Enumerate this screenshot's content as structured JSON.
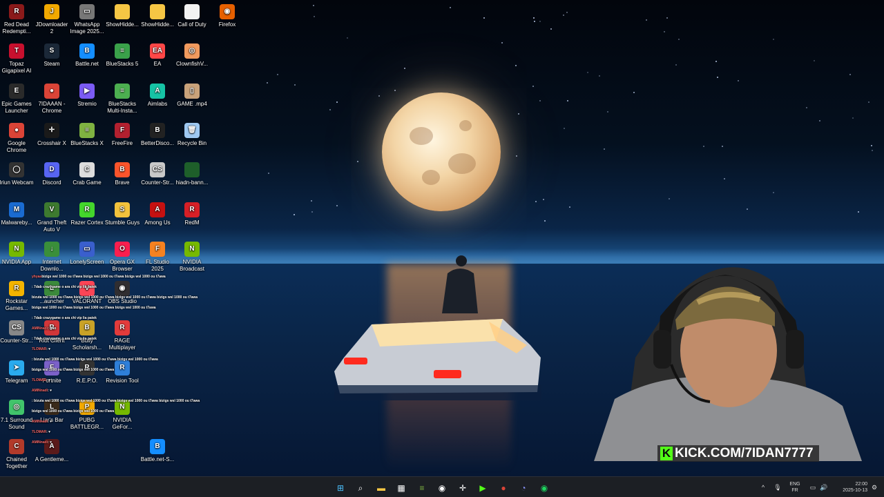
{
  "desktop": {
    "icons": [
      {
        "label": "Red Dead Redempti...",
        "icon": "red-dead-icon",
        "color": "#8b1a1a",
        "glyph": "R"
      },
      {
        "label": "JDownloader 2",
        "icon": "jdownloader-icon",
        "color": "#f2a900",
        "glyph": "J"
      },
      {
        "label": "WhatsApp Image 2025...",
        "icon": "image-file-icon",
        "color": "#777777",
        "glyph": "▭"
      },
      {
        "label": "ShowHidde...",
        "icon": "folder-icon",
        "color": "#f6c644",
        "glyph": ""
      },
      {
        "label": "ShowHidde...",
        "icon": "folder-icon",
        "color": "#f6c644",
        "glyph": ""
      },
      {
        "label": "Call of Duty",
        "icon": "document-icon",
        "color": "#f2f2f2",
        "glyph": ""
      },
      {
        "label": "Firefox",
        "icon": "firefox-icon",
        "color": "#e66000",
        "glyph": "◉"
      },
      {
        "label": "Topaz Gigapixel AI",
        "icon": "topaz-icon",
        "color": "#c8102e",
        "glyph": "T"
      },
      {
        "label": "Steam",
        "icon": "steam-icon",
        "color": "#1b2838",
        "glyph": "S"
      },
      {
        "label": "Battle.net",
        "icon": "battlenet-icon",
        "color": "#148eff",
        "glyph": "B"
      },
      {
        "label": "BlueStacks 5",
        "icon": "bluestacks-icon",
        "color": "#3aa14a",
        "glyph": "≡"
      },
      {
        "label": "EA",
        "icon": "ea-icon",
        "color": "#ff4747",
        "glyph": "EA"
      },
      {
        "label": "ClownfishV...",
        "icon": "clownfish-icon",
        "color": "#f19a5e",
        "glyph": "◎"
      },
      {
        "label": "Epic Games Launcher",
        "icon": "epic-games-icon",
        "color": "#2a2a2a",
        "glyph": "E"
      },
      {
        "label": "7IDAAAN - Chrome",
        "icon": "chrome-icon",
        "color": "#db4437",
        "glyph": "●"
      },
      {
        "label": "Stremio",
        "icon": "stremio-icon",
        "color": "#7b5bf5",
        "glyph": "▶"
      },
      {
        "label": "BlueStacks Multi-Insta...",
        "icon": "bluestacks-multi-icon",
        "color": "#4caf50",
        "glyph": "≡"
      },
      {
        "label": "Aimlabs",
        "icon": "aimlabs-icon",
        "color": "#16c3a5",
        "glyph": "A"
      },
      {
        "label": "GAME .mp4",
        "icon": "video-file-icon",
        "color": "#c9a27a",
        "glyph": "▯"
      },
      {
        "label": "Google Chrome",
        "icon": "chrome-icon",
        "color": "#db4437",
        "glyph": "●"
      },
      {
        "label": "Crosshair X",
        "icon": "crosshair-icon",
        "color": "#1a1a1a",
        "glyph": "✛"
      },
      {
        "label": "BlueStacks X",
        "icon": "bluestacks-x-icon",
        "color": "#7fb241",
        "glyph": "≡"
      },
      {
        "label": "FreeFire",
        "icon": "freefire-icon",
        "color": "#b3202f",
        "glyph": "F"
      },
      {
        "label": "BetterDisco...",
        "icon": "betterdiscord-icon",
        "color": "#222222",
        "glyph": "B"
      },
      {
        "label": "Recycle Bin",
        "icon": "recycle-bin-icon",
        "color": "#9fc9f2",
        "glyph": "🗑"
      },
      {
        "label": "Iriun Webcam",
        "icon": "webcam-icon",
        "color": "#333333",
        "glyph": "◯"
      },
      {
        "label": "Discord",
        "icon": "discord-icon",
        "color": "#5865f2",
        "glyph": "D"
      },
      {
        "label": "Crab Game",
        "icon": "crab-game-icon",
        "color": "#dddddd",
        "glyph": "C"
      },
      {
        "label": "Brave",
        "icon": "brave-icon",
        "color": "#fb542b",
        "glyph": "B"
      },
      {
        "label": "Counter-Str...",
        "icon": "counter-strike-icon",
        "color": "#c9c9c9",
        "glyph": "CS"
      },
      {
        "label": "hiadn-bann...",
        "icon": "file-icon",
        "color": "#1e5f2a",
        "glyph": ""
      },
      {
        "label": "Malwareby...",
        "icon": "malwarebytes-icon",
        "color": "#1a6bd1",
        "glyph": "M"
      },
      {
        "label": "Grand Theft Auto V",
        "icon": "gta-icon",
        "color": "#3d7a2f",
        "glyph": "V"
      },
      {
        "label": "Razer Cortex",
        "icon": "razer-icon",
        "color": "#44d62c",
        "glyph": "R"
      },
      {
        "label": "Stumble Guys",
        "icon": "stumble-guys-icon",
        "color": "#f2c23c",
        "glyph": "S"
      },
      {
        "label": "Among Us",
        "icon": "among-us-icon",
        "color": "#c51111",
        "glyph": "A"
      },
      {
        "label": "RedM",
        "icon": "redm-icon",
        "color": "#d61f26",
        "glyph": "R"
      },
      {
        "label": "NVIDIA App",
        "icon": "nvidia-icon",
        "color": "#76b900",
        "glyph": "N"
      },
      {
        "label": "Internet Downlo...",
        "icon": "idm-icon",
        "color": "#3a8f3a",
        "glyph": "↓"
      },
      {
        "label": "LonelyScreen",
        "icon": "lonelyscreen-icon",
        "color": "#3a5fcd",
        "glyph": "▭"
      },
      {
        "label": "Opera GX Browser",
        "icon": "opera-gx-icon",
        "color": "#fa1e4e",
        "glyph": "O"
      },
      {
        "label": "FL Studio 2025",
        "icon": "fl-studio-icon",
        "color": "#f58220",
        "glyph": "F"
      },
      {
        "label": "NVIDIA Broadcast",
        "icon": "nvidia-broadcast-icon",
        "color": "#76b900",
        "glyph": "N"
      },
      {
        "label": "Rockstar Games...",
        "icon": "rockstar-icon",
        "color": "#f4b400",
        "glyph": "R"
      },
      {
        "label": "...auncher",
        "icon": "launcher-icon",
        "color": "#3b8a3b",
        "glyph": "L"
      },
      {
        "label": "VALORANT",
        "icon": "valorant-icon",
        "color": "#fd4556",
        "glyph": "V"
      },
      {
        "label": "OBS Studio",
        "icon": "obs-icon",
        "color": "#302e31",
        "glyph": "◉"
      },
      {
        "label": "Counter-Str...",
        "icon": "counter-strike-icon",
        "color": "#888888",
        "glyph": "CS"
      },
      {
        "label": "Riot Client",
        "icon": "riot-icon",
        "color": "#d13639",
        "glyph": "R"
      },
      {
        "label": "Bully Scholarsh...",
        "icon": "bully-icon",
        "color": "#c9a227",
        "glyph": "B"
      },
      {
        "label": "RAGE Multiplayer",
        "icon": "ragemp-icon",
        "color": "#e23b3b",
        "glyph": "R"
      },
      {
        "label": "Telegram",
        "icon": "telegram-icon",
        "color": "#2aabee",
        "glyph": "➤"
      },
      {
        "label": "Fortnite",
        "icon": "fortnite-icon",
        "color": "#7b61c9",
        "glyph": "F"
      },
      {
        "label": "R.E.P.O.",
        "icon": "repo-icon",
        "color": "#333333",
        "glyph": "R"
      },
      {
        "label": "Revision Tool",
        "icon": "revision-tool-icon",
        "color": "#2e7fd9",
        "glyph": "R"
      },
      {
        "label": "7.1 Surround Sound",
        "icon": "surround-sound-icon",
        "color": "#41c46b",
        "glyph": "◎"
      },
      {
        "label": "Liar's Bar",
        "icon": "liars-bar-icon",
        "color": "#3a2a1a",
        "glyph": "L"
      },
      {
        "label": "PUBG BATTLEGR...",
        "icon": "pubg-icon",
        "color": "#f2a900",
        "glyph": "P"
      },
      {
        "label": "NVIDIA GeFor...",
        "icon": "nvidia-geforce-icon",
        "color": "#76b900",
        "glyph": "N"
      },
      {
        "label": "Chained Together",
        "icon": "chained-together-icon",
        "color": "#b23a2a",
        "glyph": "C"
      },
      {
        "label": "A Gentleme...",
        "icon": "gentleman-icon",
        "color": "#5a1a1a",
        "glyph": "A"
      },
      {
        "label": "Battle.net-S...",
        "icon": "battlenet-icon",
        "color": "#148eff",
        "glyph": "B"
      }
    ]
  },
  "chat": {
    "messages": [
      {
        "user": "yhyaa",
        "text": "bizigs wsl 1000 ou t7awa bizigs wsl 1000 ou t7awa bizigs wsl 1000 ou t7awa"
      },
      {
        "user": "",
        "text": ": 7dab crazygame o ara chi vip lia patek"
      },
      {
        "user": "",
        "text": "bizuta wsl 1000 ou t7awa bizigs wsl 1000 ou t7awa bizigs wsl 1000 ou t7awa bizigs wsl 1000 ou t7awa"
      },
      {
        "user": "",
        "text": "bizigs wsl 1000 ou t7awa bizigs wsl 1000 ou t7awa bizigs wsl 1000 ou t7awa"
      },
      {
        "user": "",
        "text": ": 7dab crazygame o ara chi vip lia patek"
      },
      {
        "user": "AMINnadi",
        "text": ": goo"
      },
      {
        "user": "",
        "text": ": 7dab crazygame o ara chi vip lia patek"
      },
      {
        "user": "7LOMAR",
        "text": ": ♥"
      },
      {
        "user": "",
        "text": ": bizuta wsl 1000 ou t7awa bizigs wsl 1000 ou t7awa bizigs wsl 1000 ou t7awa"
      },
      {
        "user": "",
        "text": "bizigs wsl 1000 ou t7awa bizigs wsl 1000 ou t7awa"
      },
      {
        "user": "7LOMAR",
        "text": ": ♥"
      },
      {
        "user": "AMINnadi",
        "text": ": ♥"
      },
      {
        "user": "",
        "text": ": bizuta wsl 1000 ou t7awa bizigs wsl 1000 ou t7awa bizigs wsl 1000 ou t7awa bizigs wsl 1000 ou t7awa"
      },
      {
        "user": "",
        "text": "bizigs wsl 1000 ou t7awa bizigs wsl 1000 ou t7awa"
      },
      {
        "user": "AMINnadi",
        "text": ": ♥"
      },
      {
        "user": "7LOMAR",
        "text": ": ♥"
      },
      {
        "user": "AMINnadi",
        "text": ": ♥"
      }
    ]
  },
  "stream": {
    "banner_k": "K",
    "banner_text": "KICK.COM/7IDAN7777",
    "accent": "#53fc18"
  },
  "taskbar": {
    "buttons": [
      {
        "name": "start-button",
        "icon": "windows-icon",
        "glyph": "⊞",
        "color": "#4cc2ff"
      },
      {
        "name": "search-button",
        "icon": "search-icon",
        "glyph": "⌕",
        "color": "#ffffff"
      },
      {
        "name": "file-explorer-button",
        "icon": "folder-icon",
        "glyph": "▬",
        "color": "#f6c644"
      },
      {
        "name": "store-button",
        "icon": "store-icon",
        "glyph": "▦",
        "color": "#ffffff"
      },
      {
        "name": "bluestacks-button",
        "icon": "bluestacks-icon",
        "glyph": "≡",
        "color": "#7fb241"
      },
      {
        "name": "obs-button",
        "icon": "obs-icon",
        "glyph": "◉",
        "color": "#ffffff"
      },
      {
        "name": "crosshair-button",
        "icon": "crosshair-icon",
        "glyph": "✛",
        "color": "#ffffff"
      },
      {
        "name": "streamlabs-button",
        "icon": "play-icon",
        "glyph": "▶",
        "color": "#53fc18"
      },
      {
        "name": "chrome-button",
        "icon": "chrome-icon",
        "glyph": "●",
        "color": "#db4437"
      },
      {
        "name": "discord-button",
        "icon": "discord-icon",
        "glyph": "◔",
        "color": "#8b95ff"
      },
      {
        "name": "spotify-button",
        "icon": "spotify-icon",
        "glyph": "◉",
        "color": "#1ed760"
      }
    ],
    "tray": {
      "chevron": "^",
      "mic": "🎙",
      "lang_top": "ENG",
      "lang_bottom": "FR",
      "network": "▭",
      "volume": "🔊",
      "battery": "▯",
      "time": "22:00",
      "date": "2025-10-13",
      "notification": "⚙"
    }
  }
}
